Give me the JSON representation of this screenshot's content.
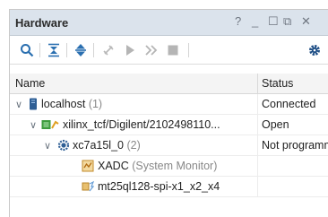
{
  "panel": {
    "title": "Hardware",
    "controls": {
      "help": "?",
      "minimize": "_",
      "maximize": "☐",
      "restore": "⧉",
      "close": "✕"
    }
  },
  "toolbar": {
    "icons": [
      "search-icon",
      "collapse-all-icon",
      "expand-all-icon",
      "auto-connect-icon",
      "run-icon",
      "fast-forward-icon",
      "stop-icon",
      "gear-icon"
    ]
  },
  "table": {
    "columns": {
      "name": "Name",
      "status": "Status"
    },
    "rows": [
      {
        "name": "localhost",
        "suffix": " (1)",
        "status": "Connected"
      },
      {
        "name": "xilinx_tcf/Digilent/2102498110...",
        "suffix": "",
        "status": "Open"
      },
      {
        "name": "xc7a15l_0",
        "suffix": " (2)",
        "status": "Not programmed"
      },
      {
        "name": "XADC",
        "suffix": " (System Monitor)",
        "status": ""
      },
      {
        "name": "mt25ql128-spi-x1_x2_x4",
        "suffix": "",
        "status": ""
      }
    ]
  }
}
